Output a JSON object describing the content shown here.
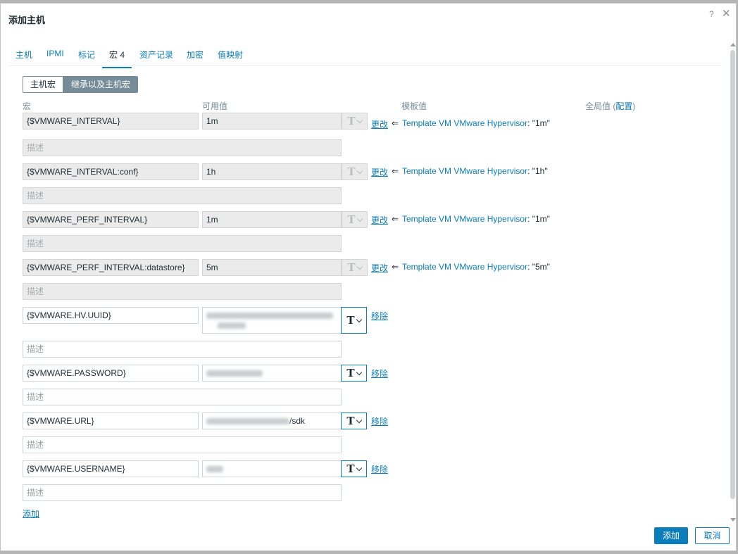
{
  "dialog": {
    "title": "添加主机",
    "help": "?",
    "close": "✕"
  },
  "tabs": [
    {
      "label": "主机"
    },
    {
      "label": "IPMI"
    },
    {
      "label": "标记"
    },
    {
      "label": "宏 4"
    },
    {
      "label": "资产记录"
    },
    {
      "label": "加密"
    },
    {
      "label": "值映射"
    }
  ],
  "segments": {
    "host_macros": "主机宏",
    "inherited_macros": "继承以及主机宏"
  },
  "columns": {
    "macro": "宏",
    "value": "可用值",
    "template_value": "模板值",
    "global_value": "全局值 (",
    "global_config": "配置",
    "global_close": ")"
  },
  "inherited_macros": [
    {
      "macro": "{$VMWARE_INTERVAL}",
      "value": "1m",
      "description": "描述",
      "action": "更改",
      "eq": "⇐",
      "template": "Template VM VMware Hypervisor",
      "template_value": ": \"1m\""
    },
    {
      "macro": "{$VMWARE_INTERVAL:conf}",
      "value": "1h",
      "description": "描述",
      "action": "更改",
      "eq": "⇐",
      "template": "Template VM VMware Hypervisor",
      "template_value": ": \"1h\""
    },
    {
      "macro": "{$VMWARE_PERF_INTERVAL}",
      "value": "1m",
      "description": "描述",
      "action": "更改",
      "eq": "⇐",
      "template": "Template VM VMware Hypervisor",
      "template_value": ": \"1m\""
    },
    {
      "macro": "{$VMWARE_PERF_INTERVAL:datastore}",
      "value": "5m",
      "description": "描述",
      "action": "更改",
      "eq": "⇐",
      "template": "Template VM VMware Hypervisor",
      "template_value": ": \"5m\""
    }
  ],
  "host_macros": [
    {
      "macro": "{$VMWARE.HV.UUID}",
      "value": "",
      "description": "描述",
      "action": "移除"
    },
    {
      "macro": "{$VMWARE.PASSWORD}",
      "value": "",
      "description": "描述",
      "action": "移除"
    },
    {
      "macro": "{$VMWARE.URL}",
      "value": "/sdk",
      "description": "描述",
      "action": "移除"
    },
    {
      "macro": "{$VMWARE.USERNAME}",
      "value": "",
      "description": "描述",
      "action": "移除"
    }
  ],
  "add_link": "添加",
  "type_glyph": "T",
  "footer": {
    "add": "添加",
    "cancel": "取消"
  },
  "colors": {
    "accent": "#0b7dba",
    "segment_active": "#768d99",
    "readonly_bg": "#ebebeb"
  }
}
